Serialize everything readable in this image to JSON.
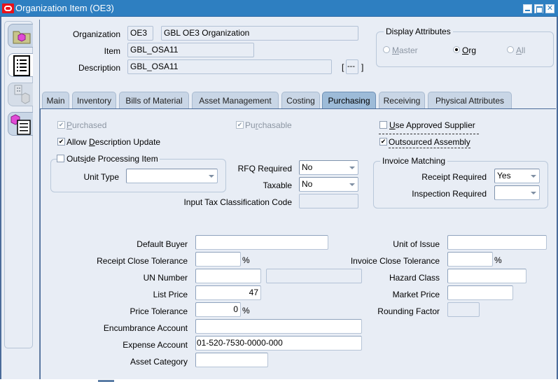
{
  "window": {
    "title": "Organization Item (OE3)",
    "controls": [
      "minimize",
      "maximize",
      "close"
    ]
  },
  "sidebar": {
    "items": [
      {
        "name": "organization-assignment",
        "icon": "folder-cube-icon",
        "state": "normal"
      },
      {
        "name": "attributes",
        "icon": "document-list-icon",
        "state": "active"
      },
      {
        "name": "categories",
        "icon": "building-cube-icon",
        "state": "disabled"
      },
      {
        "name": "item-revisions",
        "icon": "cube-list-icon",
        "state": "normal"
      }
    ]
  },
  "header": {
    "organization_label": "Organization",
    "organization_code": "OE3",
    "organization_name": "GBL OE3 Organization",
    "item_label": "Item",
    "item_value": "GBL_OSA11",
    "description_label": "Description",
    "description_value": "GBL_OSA11",
    "flex_field": "---",
    "flex_open": "[",
    "flex_close": "]"
  },
  "display_attributes": {
    "title": "Display Attributes",
    "options": [
      {
        "label": "Master",
        "mnemonic": "M",
        "rest": "aster",
        "selected": false,
        "enabled": false
      },
      {
        "label": "Org",
        "mnemonic": "O",
        "rest": "rg",
        "selected": true,
        "enabled": true
      },
      {
        "label": "All",
        "mnemonic": "A",
        "rest": "ll",
        "selected": false,
        "enabled": false
      }
    ]
  },
  "tabs": [
    {
      "label": "Main",
      "active": false
    },
    {
      "label": "Inventory",
      "active": false
    },
    {
      "label": "Bills of Material",
      "active": false
    },
    {
      "label": "Asset Management",
      "active": false
    },
    {
      "label": "Costing",
      "active": false
    },
    {
      "label": "Purchasing",
      "active": true
    },
    {
      "label": "Receiving",
      "active": false
    },
    {
      "label": "Physical Attributes",
      "active": false
    }
  ],
  "purchasing": {
    "purchased": {
      "pre": "",
      "mn": "P",
      "post": "urchased",
      "checked": true,
      "enabled": false
    },
    "purchasable": {
      "pre": "Pu",
      "mn": "r",
      "post": "chasable",
      "checked": true,
      "enabled": false
    },
    "use_approved_supplier": {
      "pre": "",
      "mn": "U",
      "post": "se Approved Supplier",
      "checked": false,
      "enabled": true
    },
    "allow_description_update": {
      "pre": "Allow ",
      "mn": "D",
      "post": "escription Update",
      "checked": true,
      "enabled": true
    },
    "outsourced_assembly": {
      "label": "Outsourced Assembly",
      "checked": true,
      "enabled": true
    },
    "outside_processing": {
      "title_pre": "Outs",
      "title_mn": "i",
      "title_post": "de Processing Item",
      "checked": false,
      "unit_type_label": "Unit Type",
      "unit_type_value": ""
    },
    "rfq_required": {
      "label": "RFQ Required",
      "value": "No"
    },
    "taxable": {
      "label": "Taxable",
      "value": "No"
    },
    "input_tax_code": {
      "label": "Input Tax Classification Code",
      "value": ""
    },
    "invoice_matching": {
      "title": "Invoice Matching",
      "receipt_required": {
        "label": "Receipt Required",
        "value": "Yes"
      },
      "inspection_required": {
        "label": "Inspection Required",
        "value": ""
      }
    },
    "default_buyer": {
      "label": "Default Buyer",
      "value": ""
    },
    "receipt_close_tolerance": {
      "label": "Receipt Close Tolerance",
      "value": "",
      "unit": "%"
    },
    "un_number": {
      "label": "UN Number",
      "value": "",
      "description": ""
    },
    "list_price": {
      "label": "List Price",
      "value": "47"
    },
    "price_tolerance": {
      "label": "Price Tolerance",
      "value": "0",
      "unit": "%"
    },
    "encumbrance_account": {
      "label": "Encumbrance Account",
      "value": ""
    },
    "expense_account": {
      "label": "Expense Account",
      "value": "01-520-7530-0000-000"
    },
    "asset_category": {
      "label": "Asset Category",
      "value": ""
    },
    "unit_of_issue": {
      "label": "Unit of Issue",
      "value": ""
    },
    "invoice_close_tolerance": {
      "label": "Invoice Close Tolerance",
      "value": "",
      "unit": "%"
    },
    "hazard_class": {
      "label": "Hazard Class",
      "value": ""
    },
    "market_price": {
      "label": "Market Price",
      "value": ""
    },
    "rounding_factor": {
      "label": "Rounding Factor",
      "value": ""
    }
  },
  "colors": {
    "titlebar": "#2e7fc1",
    "background": "#e8edf5",
    "active_tab": "#9dbbd8",
    "inactive_tab": "#c9d6e6",
    "frame_border": "#4a6b9a"
  }
}
